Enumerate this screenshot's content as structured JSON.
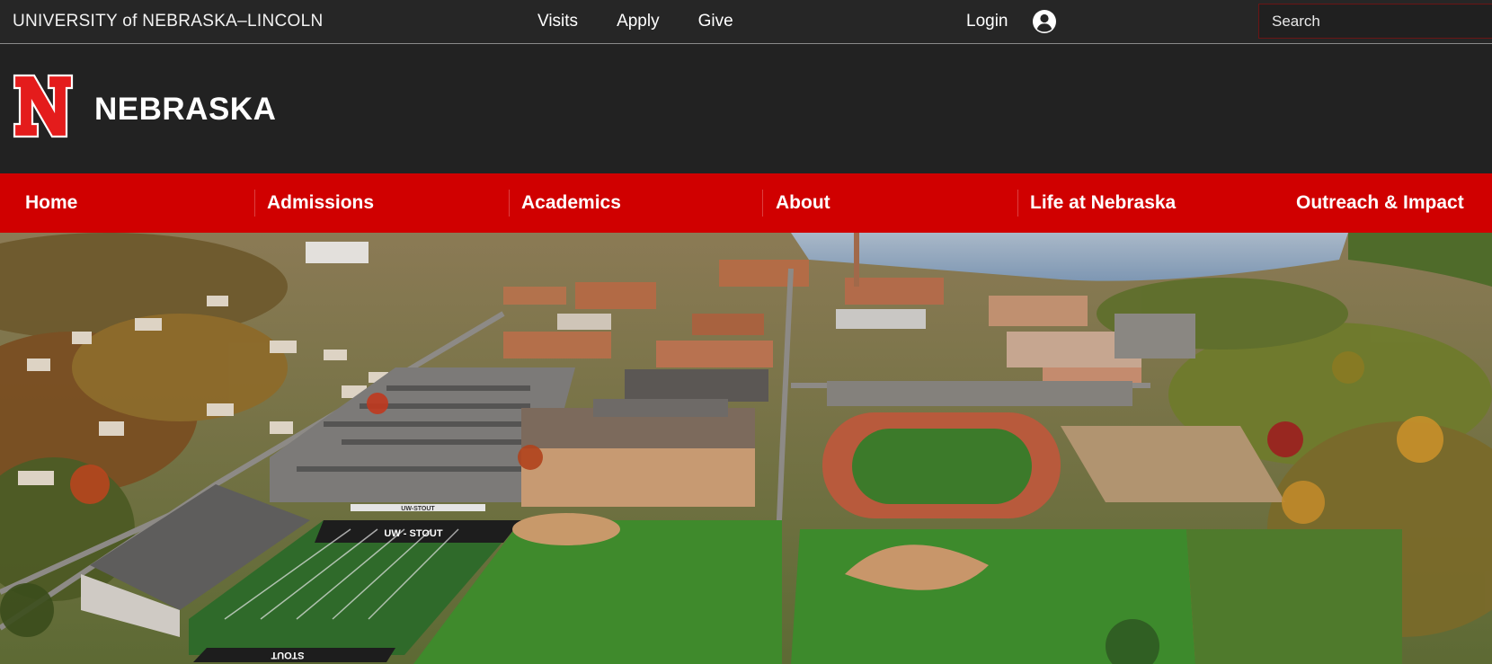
{
  "utility": {
    "university": "UNIVERSITY of NEBRASKA–LINCOLN",
    "links": [
      "Visits",
      "Apply",
      "Give"
    ],
    "login_label": "Login",
    "search_placeholder": "Search"
  },
  "brand": {
    "logo_letter": "N",
    "name": "NEBRASKA"
  },
  "nav": {
    "items": [
      "Home",
      "Admissions",
      "Academics",
      "About",
      "Life at Nebraska",
      "Outreach & Impact"
    ]
  },
  "hero": {
    "stadium_sign": "UW - STOUT",
    "stadium_sign_lower": "STOUT",
    "banner": "UW-STOUT"
  },
  "colors": {
    "brand_red": "#d00000",
    "bar_dark": "#222222"
  }
}
